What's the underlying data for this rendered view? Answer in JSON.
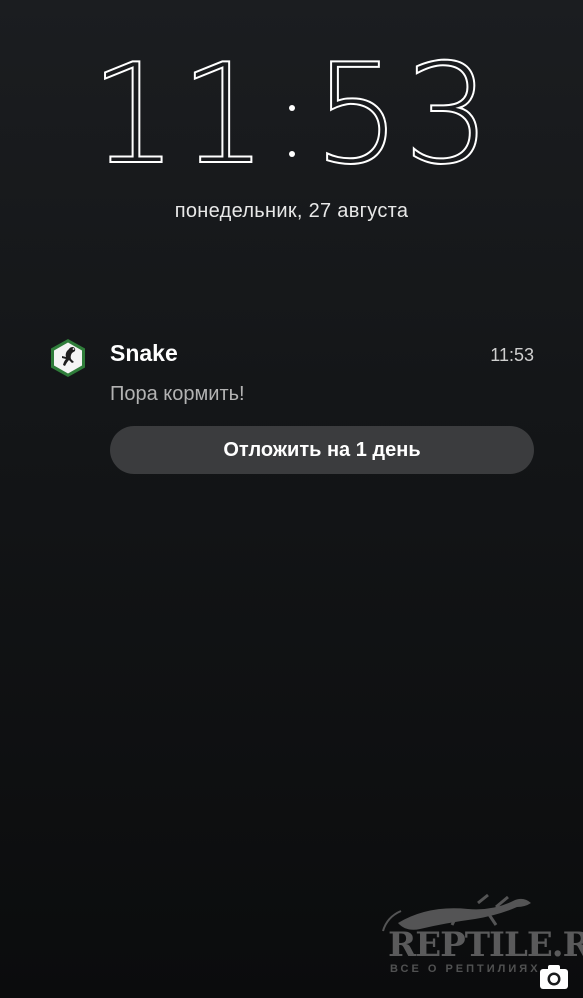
{
  "lockscreen": {
    "clock_hours": "11",
    "clock_minutes": "53",
    "date": "понедельник,  27 августа"
  },
  "notification": {
    "app_name": "Snake",
    "time": "11:53",
    "message": "Пора кормить!",
    "action_label": "Отложить на 1 день",
    "icon": "lizard-app-icon",
    "icon_color": "#2f7d3a"
  },
  "watermark": {
    "title": "REPTILE.RU",
    "subtitle": "ВСЕ О РЕПТИЛИЯХ"
  },
  "shortcuts": {
    "camera_icon": "camera-icon"
  }
}
